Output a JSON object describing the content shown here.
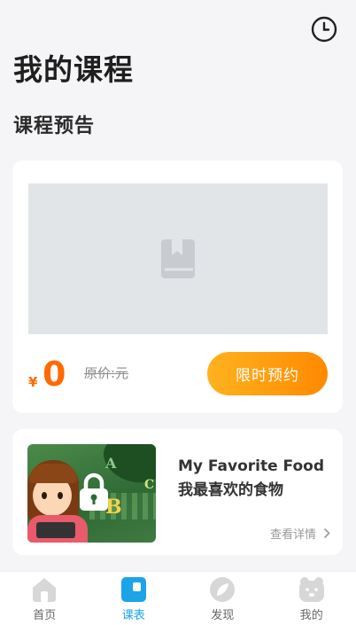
{
  "page": {
    "title": "我的课程"
  },
  "preview": {
    "section_title": "课程预告",
    "currency": "¥",
    "price": "0",
    "original_price": "原价:元",
    "reserve_label": "限时预约"
  },
  "course": {
    "title": "My Favorite Food 我最喜欢的食物",
    "detail_label": "查看详情",
    "locked": true
  },
  "tabbar": {
    "items": [
      {
        "label": "首页",
        "icon": "home-icon",
        "active": false
      },
      {
        "label": "课表",
        "icon": "schedule-icon",
        "active": true
      },
      {
        "label": "发现",
        "icon": "discover-icon",
        "active": false
      },
      {
        "label": "我的",
        "icon": "profile-icon",
        "active": false
      }
    ]
  },
  "colors": {
    "accent": "#ff8a00",
    "active_tab": "#1ca3e8"
  }
}
